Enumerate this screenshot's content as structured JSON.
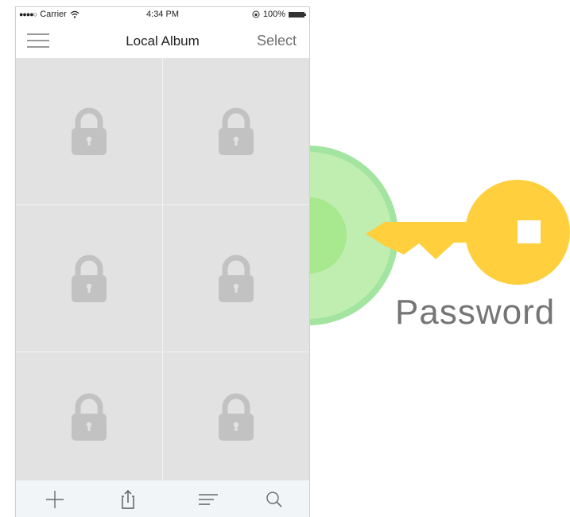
{
  "status_bar": {
    "signal": "●●●●○",
    "carrier": "Carrier",
    "time": "4:34 PM",
    "battery": "100%",
    "battery_level": 1.0
  },
  "navbar": {
    "title": "Local Album",
    "select_label": "Select"
  },
  "album": {
    "items": [
      {
        "icon": "lock-icon"
      },
      {
        "icon": "lock-icon"
      },
      {
        "icon": "lock-icon"
      },
      {
        "icon": "lock-icon"
      },
      {
        "icon": "lock-icon"
      },
      {
        "icon": "lock-icon"
      }
    ]
  },
  "tab_bar": {
    "items": [
      {
        "icon": "plus-icon"
      },
      {
        "icon": "share-icon"
      },
      {
        "icon": "sort-icon"
      },
      {
        "icon": "search-icon"
      }
    ]
  },
  "illustration": {
    "label": "Password",
    "key_color": "#ffcf3d",
    "circle_color": "#bfeeb0",
    "ring_color": "#a2e4a0",
    "inner_color": "#a8e88e"
  },
  "colors": {
    "lock_gray": "#c2c2c2",
    "tile_gray": "#e2e2e2",
    "tab_icon": "#6a6a6a"
  }
}
